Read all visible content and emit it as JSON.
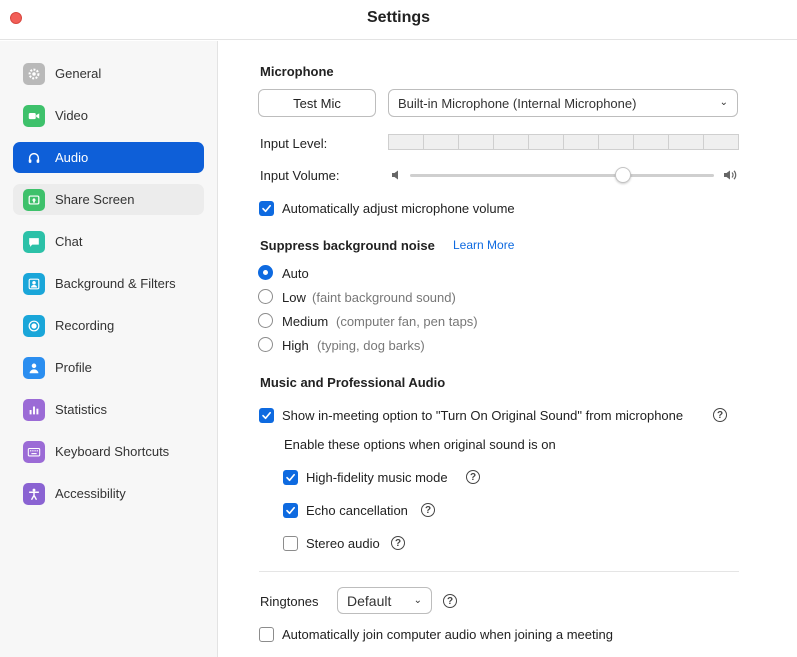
{
  "window": {
    "title": "Settings"
  },
  "sidebar": {
    "items": [
      {
        "label": "General",
        "icon": "gear-icon",
        "color": "#b9b9b9"
      },
      {
        "label": "Video",
        "icon": "video-camera-icon",
        "color": "#3ec16b"
      },
      {
        "label": "Audio",
        "icon": "headphones-icon",
        "color": "#0e5fd8"
      },
      {
        "label": "Share Screen",
        "icon": "share-screen-icon",
        "color": "#3ec16b"
      },
      {
        "label": "Chat",
        "icon": "chat-bubble-icon",
        "color": "#2cc1a8"
      },
      {
        "label": "Background & Filters",
        "icon": "person-frame-icon",
        "color": "#1aa6d9"
      },
      {
        "label": "Recording",
        "icon": "record-icon",
        "color": "#1aa6d9"
      },
      {
        "label": "Profile",
        "icon": "person-icon",
        "color": "#2b8ef0"
      },
      {
        "label": "Statistics",
        "icon": "bar-chart-icon",
        "color": "#9b6bd6"
      },
      {
        "label": "Keyboard Shortcuts",
        "icon": "keyboard-icon",
        "color": "#9b6bd6"
      },
      {
        "label": "Accessibility",
        "icon": "accessibility-icon",
        "color": "#8a63d2"
      }
    ],
    "active_index": 2,
    "hover_index": 3
  },
  "microphone": {
    "heading": "Microphone",
    "test_button": "Test Mic",
    "device": "Built-in Microphone (Internal Microphone)",
    "input_level_label": "Input Level:",
    "input_level_segments": 10,
    "input_level_value": 0,
    "input_volume_label": "Input Volume:",
    "input_volume_value": 0.7,
    "auto_adjust_label": "Automatically adjust microphone volume",
    "auto_adjust_checked": true
  },
  "noise": {
    "heading": "Suppress background noise",
    "learn_more": "Learn More",
    "options": [
      {
        "label": "Auto",
        "hint": "",
        "selected": true
      },
      {
        "label": "Low",
        "hint": "(faint background sound)",
        "selected": false
      },
      {
        "label": "Medium",
        "hint": "(computer fan, pen taps)",
        "selected": false
      },
      {
        "label": "High",
        "hint": "(typing, dog barks)",
        "selected": false
      }
    ]
  },
  "music": {
    "heading": "Music and Professional Audio",
    "show_original_sound_label": "Show in-meeting option to \"Turn On Original Sound\" from microphone",
    "show_original_sound_checked": true,
    "enable_note": "Enable these options when original sound is on",
    "hifi_label": "High-fidelity music mode",
    "hifi_checked": true,
    "echo_label": "Echo cancellation",
    "echo_checked": true,
    "stereo_label": "Stereo audio",
    "stereo_checked": false
  },
  "ringtones": {
    "label": "Ringtones",
    "value": "Default"
  },
  "auto_join": {
    "label": "Automatically join computer audio when joining a meeting",
    "checked": false
  },
  "colors": {
    "accent": "#0e5fd8",
    "checkbox": "#0e6ae0",
    "close": "#f25f58"
  }
}
